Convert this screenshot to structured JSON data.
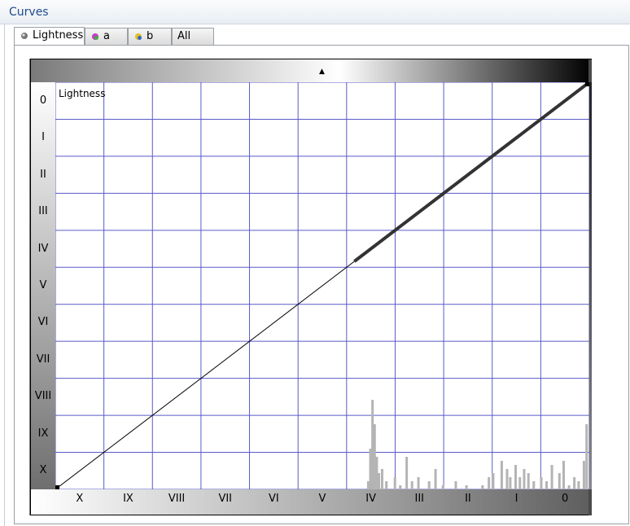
{
  "panel": {
    "title": "Curves"
  },
  "tabs": [
    {
      "label": "Lightness",
      "active": true,
      "icon": "lightness-dot-icon"
    },
    {
      "label": "a",
      "active": false,
      "icon": "a-channel-icon"
    },
    {
      "label": "b",
      "active": false,
      "icon": "b-channel-icon"
    },
    {
      "label": "All",
      "active": false,
      "icon": ""
    }
  ],
  "chart_data": {
    "type": "line",
    "title": "Lightness",
    "x_tick_labels": [
      "X",
      "IX",
      "VIII",
      "VII",
      "VI",
      "V",
      "IV",
      "III",
      "II",
      "I",
      "0"
    ],
    "y_tick_labels": [
      "0",
      "I",
      "II",
      "III",
      "IV",
      "V",
      "VI",
      "VII",
      "VIII",
      "IX",
      "X"
    ],
    "xlim": [
      0,
      1
    ],
    "ylim": [
      0,
      1
    ],
    "grid": true,
    "grid_divisions": 11,
    "series": [
      {
        "x": [
          0,
          1
        ],
        "y": [
          0,
          1
        ],
        "style": "thin",
        "color": "#000000"
      },
      {
        "x": [
          0.56,
          1
        ],
        "y": [
          0.56,
          1
        ],
        "style": "thick",
        "color": "#333333"
      }
    ],
    "histogram": [
      [
        0.586,
        0.02
      ],
      [
        0.59,
        0.1
      ],
      [
        0.594,
        0.22
      ],
      [
        0.598,
        0.16
      ],
      [
        0.602,
        0.08
      ],
      [
        0.606,
        0.04
      ],
      [
        0.612,
        0.05
      ],
      [
        0.62,
        0.02
      ],
      [
        0.636,
        0.03
      ],
      [
        0.646,
        0.01
      ],
      [
        0.658,
        0.08
      ],
      [
        0.668,
        0.02
      ],
      [
        0.68,
        0.03
      ],
      [
        0.7,
        0.02
      ],
      [
        0.712,
        0.05
      ],
      [
        0.726,
        0.01
      ],
      [
        0.75,
        0.02
      ],
      [
        0.77,
        0.01
      ],
      [
        0.8,
        0.01
      ],
      [
        0.812,
        0.03
      ],
      [
        0.82,
        0.04
      ],
      [
        0.836,
        0.07
      ],
      [
        0.846,
        0.05
      ],
      [
        0.852,
        0.03
      ],
      [
        0.862,
        0.06
      ],
      [
        0.87,
        0.03
      ],
      [
        0.878,
        0.05
      ],
      [
        0.886,
        0.04
      ],
      [
        0.896,
        0.02
      ],
      [
        0.91,
        0.03
      ],
      [
        0.92,
        0.02
      ],
      [
        0.93,
        0.06
      ],
      [
        0.944,
        0.04
      ],
      [
        0.952,
        0.07
      ],
      [
        0.962,
        0.01
      ],
      [
        0.972,
        0.03
      ],
      [
        0.98,
        0.02
      ],
      [
        0.99,
        0.07
      ],
      [
        0.995,
        0.16
      ]
    ],
    "colors": {
      "grid": "#5a5ac8",
      "curve": "#000000",
      "histogram": "#b4b4b4"
    }
  }
}
